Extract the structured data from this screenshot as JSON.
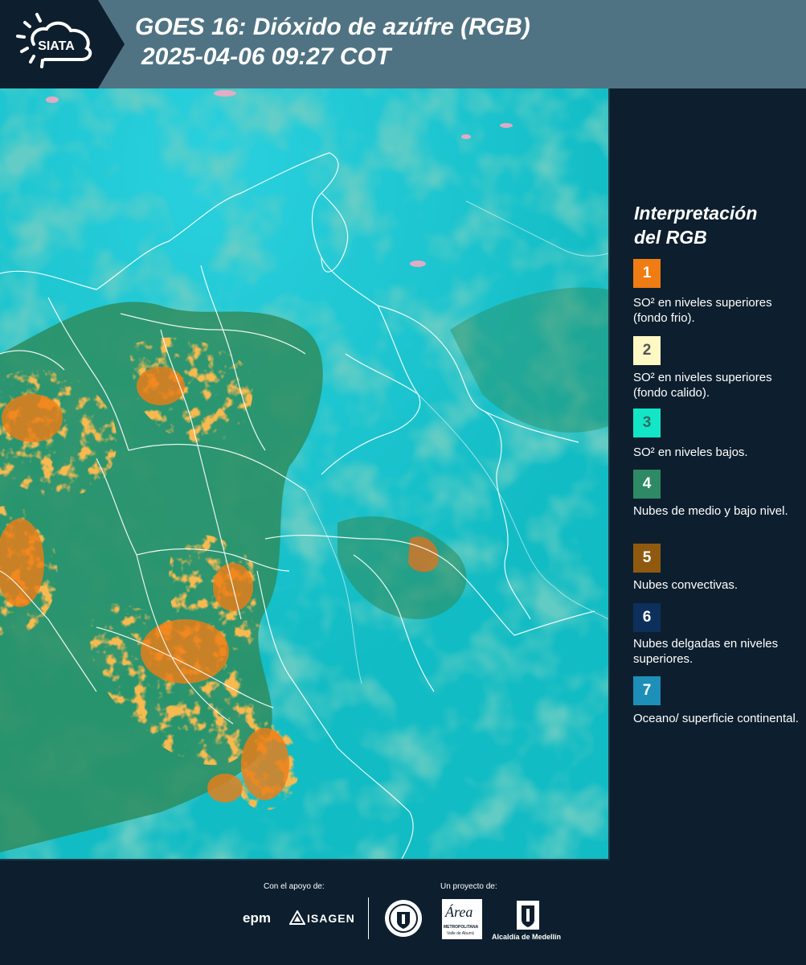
{
  "header": {
    "logo_text": "SIATA",
    "title_line1": "GOES 16: Dióxido de azúfre (RGB)",
    "title_line2": "2025-04-06 09:27 COT"
  },
  "legend": {
    "title_line1": "Interpretación",
    "title_line2": "del RGB",
    "items": [
      {
        "number": "1",
        "label": "SO² en niveles superiores (fondo frio).",
        "color": "#f07c14",
        "text_color": "#ffffff"
      },
      {
        "number": "2",
        "label": "SO² en niveles superiores (fondo calido).",
        "color": "#fdf8c4",
        "text_color": "#555555"
      },
      {
        "number": "3",
        "label": "SO² en niveles bajos.",
        "color": "#13e6c6",
        "text_color": "#2e6e66"
      },
      {
        "number": "4",
        "label": "Nubes de medio y bajo nivel.",
        "color": "#2d8a64",
        "text_color": "#ffffff"
      },
      {
        "number": "5",
        "label": "Nubes convectivas.",
        "color": "#8f5a0f",
        "text_color": "#ffffff"
      },
      {
        "number": "6",
        "label": "Nubes delgadas en niveles superiores.",
        "color": "#0d2f5c",
        "text_color": "#ffffff"
      },
      {
        "number": "7",
        "label": "Oceano/ superficie continental.",
        "color": "#1d8fb8",
        "text_color": "#ffffff"
      }
    ]
  },
  "footer": {
    "support_label": "Con el apoyo de:",
    "project_label": "Un proyecto de:",
    "epm_text": "epm",
    "isagen_text": "ISAGEN",
    "area_text": "Área",
    "area_sub1": "METROPOLITANA",
    "area_sub2": "Valle de Aburrá",
    "alcaldia_text": "Alcaldía de Medellín"
  },
  "colors": {
    "header_bg": "#4f7383",
    "panel_bg": "#0d1f2e",
    "ocean_cyan": "#19c2d2",
    "cloud_orange": "#f07c14",
    "cloud_green": "#2d8a64"
  }
}
